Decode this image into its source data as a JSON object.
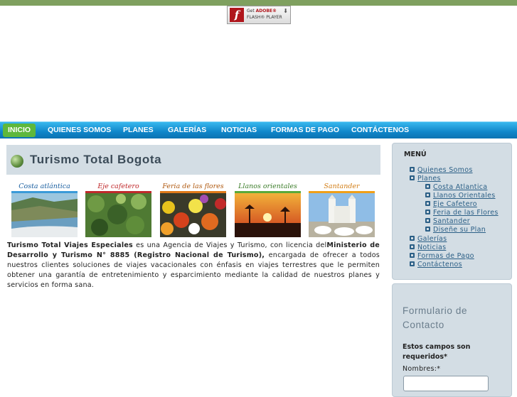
{
  "flash_badge": {
    "line1_prefix": "Get ",
    "line1_brand": "ADOBE®",
    "line2": "FLASH® PLAYER",
    "icon": "f",
    "download_icon": "download-arrow-icon"
  },
  "nav": {
    "items": [
      {
        "label": "INICIO",
        "active": true
      },
      {
        "label": "QUIENES SOMOS"
      },
      {
        "label": "PLANES"
      },
      {
        "label": "GALERÍAS"
      },
      {
        "label": "NOTICIAS"
      },
      {
        "label": "FORMAS DE PAGO"
      },
      {
        "label": "CONTÁCTENOS"
      }
    ]
  },
  "main": {
    "title": "Turismo Total Bogota",
    "thumbnails": [
      {
        "label": "Costa atlántica",
        "label_color": "#1a5fa0",
        "bar_color": "#3a9ad8"
      },
      {
        "label": "Eje cafetero",
        "label_color": "#c0292b",
        "bar_color": "#c0292b"
      },
      {
        "label": "Feria de las flores",
        "label_color": "#b05a10",
        "bar_color": "#e07a1a"
      },
      {
        "label": "Llanos orientales",
        "label_color": "#3c7d2a",
        "bar_color": "#5aa93a"
      },
      {
        "label": "Santander",
        "label_color": "#d27d14",
        "bar_color": "#f0a018"
      }
    ],
    "intro": {
      "bold1": "Turismo Total Viajes Especiales",
      "text1": " es una Agencia de Viajes y Turismo, con licencia del",
      "bold2": "Ministerio de Desarrollo y Turismo N° 8885 (Registro Nacional de Turismo),",
      "text2": " encargada de ofrecer a todos nuestros clientes soluciones de viajes vacacionales con énfasis en viajes terrestres que le permiten obtener una garantía de entretenimiento y esparcimiento mediante la calidad de nuestros planes y servicios en forma sana."
    }
  },
  "sidebar": {
    "menu_title": "MENÚ",
    "items": [
      {
        "label": "Quienes Somos",
        "level": 1
      },
      {
        "label": "Planes",
        "level": 1
      },
      {
        "label": "Costa Atlantica",
        "level": 2
      },
      {
        "label": "Llanos Orientales",
        "level": 2
      },
      {
        "label": "Eje Cafetero",
        "level": 2
      },
      {
        "label": "Feria de las Flores",
        "level": 2
      },
      {
        "label": "Santander",
        "level": 2
      },
      {
        "label": "Diseñe su Plan",
        "level": 2
      },
      {
        "label": "Galerías",
        "level": 1
      },
      {
        "label": "Noticias",
        "level": 1
      },
      {
        "label": "Formas de Pago",
        "level": 1
      },
      {
        "label": "Contáctenos",
        "level": 1
      }
    ],
    "form": {
      "title": "Formulario de Contacto",
      "required_note": "Estos campos son requeridos*",
      "name_label": "Nombres:*",
      "name_value": ""
    }
  }
}
